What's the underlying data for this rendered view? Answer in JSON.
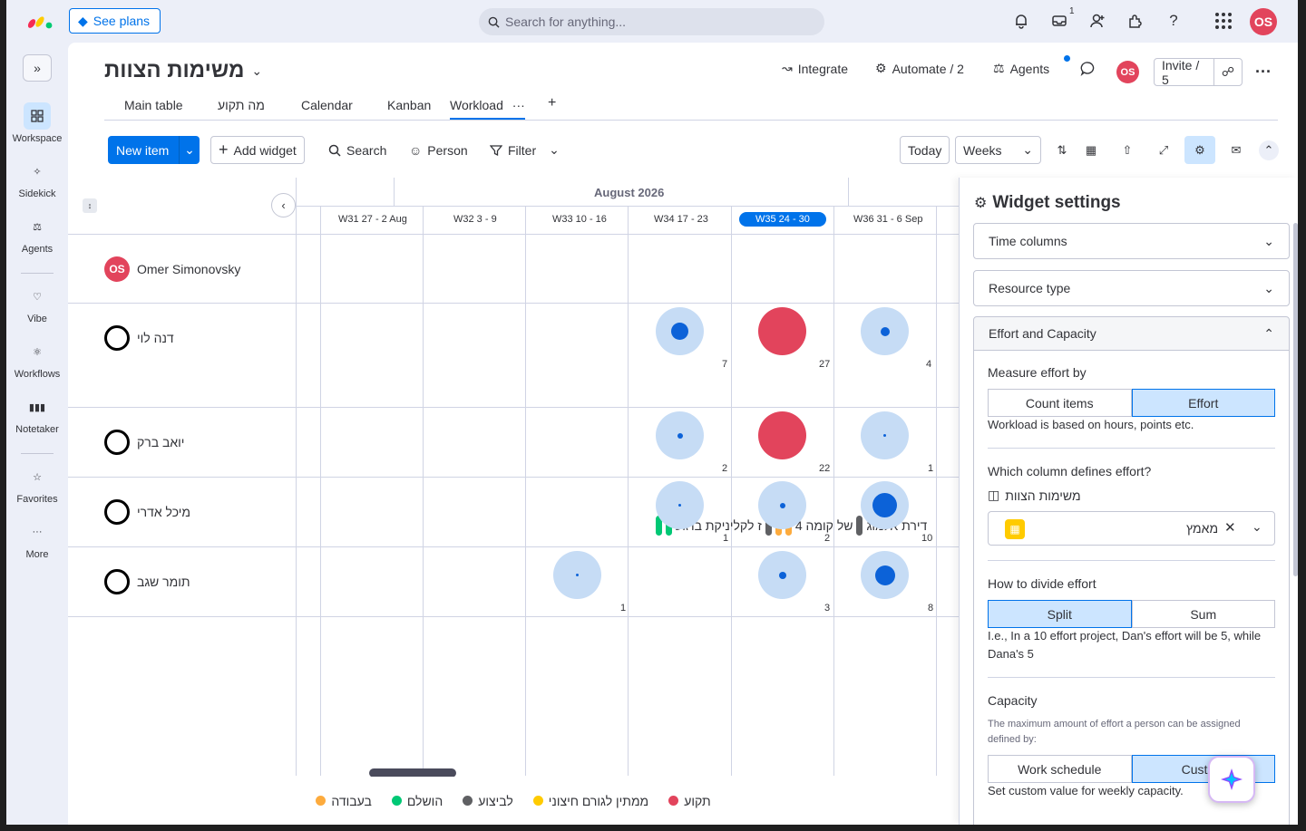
{
  "topbar": {
    "see_plans": "See plans",
    "search_placeholder": "Search for anything...",
    "inbox_badge": "1",
    "user_initials": "OS"
  },
  "rail": {
    "items": [
      {
        "label": "Workspace",
        "icon": "workspace-icon"
      },
      {
        "label": "Sidekick",
        "icon": "sidekick-icon"
      },
      {
        "label": "Agents",
        "icon": "agents-icon"
      },
      {
        "label": "Vibe",
        "icon": "vibe-icon"
      },
      {
        "label": "Workflows",
        "icon": "workflows-icon"
      },
      {
        "label": "Notetaker",
        "icon": "notetaker-icon"
      },
      {
        "label": "Favorites",
        "icon": "star-icon"
      },
      {
        "label": "More",
        "icon": "more-icon"
      }
    ]
  },
  "board": {
    "title": "משימות הצוות",
    "integrate": "Integrate",
    "automate": "Automate / 2",
    "agents": "Agents",
    "invite": "Invite / 5",
    "user_initials": "OS"
  },
  "tabs": [
    "Main table",
    "מה תקוע",
    "Calendar",
    "Kanban",
    "Workload"
  ],
  "toolbar": {
    "new_item": "New item",
    "add_widget": "Add widget",
    "search": "Search",
    "person": "Person",
    "filter": "Filter",
    "today": "Today",
    "weeks": "Weeks"
  },
  "workload": {
    "month": "August 2026",
    "weeks": [
      "W31 27 - 2 Aug",
      "W32 3 - 9",
      "W33 10 - 16",
      "W34 17 - 23",
      "W35 24 - 30",
      "W36 31 - 6 Sep"
    ],
    "current_week": "W35 24 - 30",
    "people": [
      {
        "name": "Omer Simonovsky",
        "initials": "OS",
        "counts": []
      },
      {
        "name": "דנה לוי",
        "counts": [
          {
            "week": 3,
            "value": "7"
          },
          {
            "week": 4,
            "value": "27"
          },
          {
            "week": 5,
            "value": "4"
          }
        ]
      },
      {
        "name": "יואב ברק",
        "counts": [
          {
            "week": 3,
            "value": "2"
          },
          {
            "week": 4,
            "value": "22"
          },
          {
            "week": 5,
            "value": "1"
          }
        ]
      },
      {
        "name": "מיכל אדרי",
        "counts": [
          {
            "week": 3,
            "value": "1"
          },
          {
            "week": 4,
            "value": "2"
          },
          {
            "week": 5,
            "value": "10"
          }
        ]
      },
      {
        "name": "תומר שגב",
        "counts": [
          {
            "week": 2,
            "value": "1"
          },
          {
            "week": 4,
            "value": "3"
          },
          {
            "week": 5,
            "value": "8"
          }
        ]
      }
    ],
    "item_strip": {
      "a": "ז לקליניקת ברגע",
      "b": "4 של קומה",
      "c": "דירת אלמוג"
    },
    "legend": [
      {
        "label": "בעבודה",
        "color": "#fdab3d"
      },
      {
        "label": "הושלם",
        "color": "#00c875"
      },
      {
        "label": "לביצוע",
        "color": "#5f6063"
      },
      {
        "label": "ממתין לגורם חיצוני",
        "color": "#ffcb00"
      },
      {
        "label": "תקוע",
        "color": "#e2445c"
      }
    ]
  },
  "panel": {
    "title": "Widget settings",
    "time_columns": "Time columns",
    "resource_type": "Resource type",
    "effort_capacity": "Effort and Capacity",
    "measure_label": "Measure effort by",
    "measure_options": [
      "Count items",
      "Effort"
    ],
    "measure_selected": "Effort",
    "measure_desc": "Workload is based on hours, points etc.",
    "which_column": "Which column defines effort?",
    "board_name": "משימות הצוות",
    "column_value": "מאמץ",
    "divide_label": "How to divide effort",
    "divide_options": [
      "Split",
      "Sum"
    ],
    "divide_selected": "Split",
    "divide_desc": "I.e., In a 10 effort project, Dan's effort will be 5, while Dana's 5",
    "capacity_label": "Capacity",
    "capacity_small": "The maximum amount of effort a person can be assigned defined by:",
    "capacity_options": [
      "Work schedule",
      "Custom"
    ],
    "capacity_selected": "Custom",
    "capacity_desc": "Set custom value for weekly capacity."
  },
  "colors": {
    "primary": "#0073ea",
    "selected_bg": "#cce5ff",
    "overload": "#e2445c",
    "bubble_light": "#c6dcf5",
    "bubble_dot": "#0c62d8"
  }
}
